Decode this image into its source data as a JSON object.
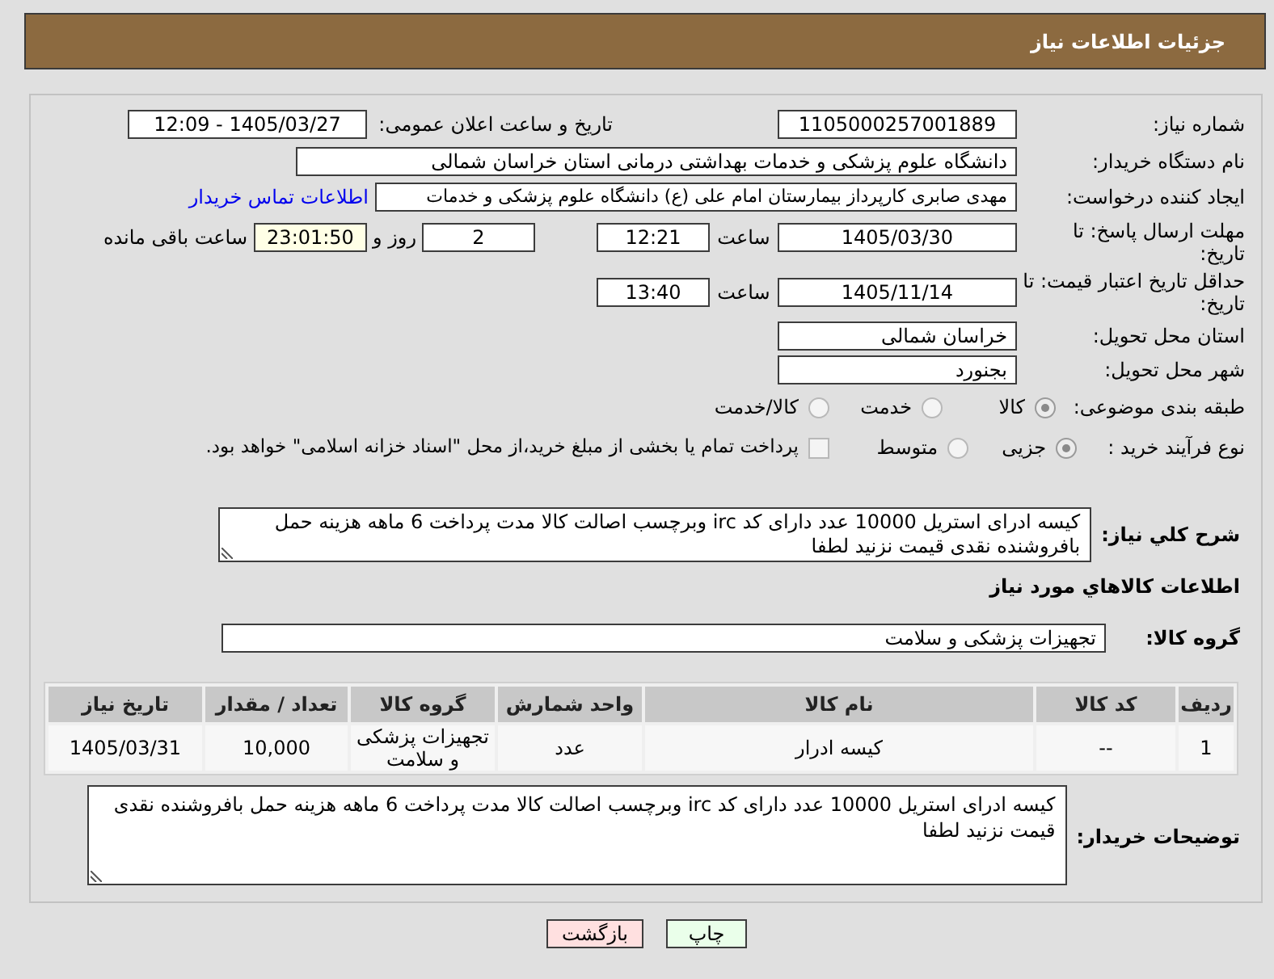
{
  "header": {
    "title": "جزئیات اطلاعات نیاز"
  },
  "need_number": {
    "label": "شماره نیاز:",
    "value": "1105000257001889"
  },
  "announcement": {
    "label": "تاریخ و ساعت اعلان عمومی:",
    "value": "1405/03/27 - 12:09"
  },
  "buyer_org": {
    "label": "نام دستگاه خریدار:",
    "value": "دانشگاه علوم پزشکی و خدمات بهداشتی درمانی استان خراسان شمالی"
  },
  "requester": {
    "label": "ایجاد کننده درخواست:",
    "value": "مهدی صابری کارپرداز بیمارستان امام علی (ع) دانشگاه علوم پزشکی و خدمات",
    "link": "اطلاعات تماس خریدار"
  },
  "response_deadline": {
    "label": "مهلت ارسال پاسخ: تا تاریخ:",
    "date": "1405/03/30",
    "time_label": "ساعت",
    "time": "12:21",
    "days": "2",
    "days_label": "روز و",
    "remaining": "23:01:50",
    "remaining_label": "ساعت باقی مانده"
  },
  "price_validity": {
    "label": "حداقل تاریخ اعتبار قیمت: تا تاریخ:",
    "date": "1405/11/14",
    "time_label": "ساعت",
    "time": "13:40"
  },
  "delivery_province": {
    "label": "استان محل تحویل:",
    "value": "خراسان شمالی"
  },
  "delivery_city": {
    "label": "شهر محل تحویل:",
    "value": "بجنورد"
  },
  "category": {
    "label": "طبقه بندی موضوعی:",
    "options": [
      {
        "label": "کالا",
        "selected": true
      },
      {
        "label": "خدمت",
        "selected": false
      },
      {
        "label": "کالا/خدمت",
        "selected": false
      }
    ]
  },
  "purchase_process": {
    "label": "نوع فرآیند خرید :",
    "options": [
      {
        "label": "جزیی",
        "selected": true
      },
      {
        "label": "متوسط",
        "selected": false
      }
    ],
    "treasury": {
      "label": "پرداخت تمام یا بخشی از مبلغ خرید،از محل \"اسناد خزانه اسلامی\" خواهد بود.",
      "checked": false
    }
  },
  "description": {
    "label": "شرح کلي نیاز:",
    "value": "کیسه ادرای استریل 10000 عدد دارای کد irc وبرچسب اصالت کالا مدت پرداخت 6 ماهه هزینه حمل بافروشنده نقدی قیمت نزنید لطفا"
  },
  "goods_section": {
    "title": "اطلاعات کالاهاي مورد نیاز"
  },
  "goods_group": {
    "label": "گروه کالا:",
    "value": "تجهیزات پزشکی و سلامت"
  },
  "table": {
    "columns": [
      "ردیف",
      "کد کالا",
      "نام کالا",
      "واحد شمارش",
      "گروه کالا",
      "تعداد / مقدار",
      "تاریخ نیاز"
    ],
    "rows": [
      [
        "1",
        "--",
        "کیسه ادرار",
        "عدد",
        "تجهیزات پزشکی و سلامت",
        "10,000",
        "1405/03/31"
      ]
    ]
  },
  "buyer_notes": {
    "label": "توضیحات خریدار:",
    "value": "کیسه ادرای استریل 10000 عدد دارای کد irc وبرچسب اصالت کالا مدت پرداخت 6 ماهه هزینه حمل بافروشنده نقدی قیمت نزنید لطفا"
  },
  "buttons": [
    {
      "label": "چاپ",
      "kind": "print"
    },
    {
      "label": "بازگشت",
      "kind": "back"
    }
  ]
}
